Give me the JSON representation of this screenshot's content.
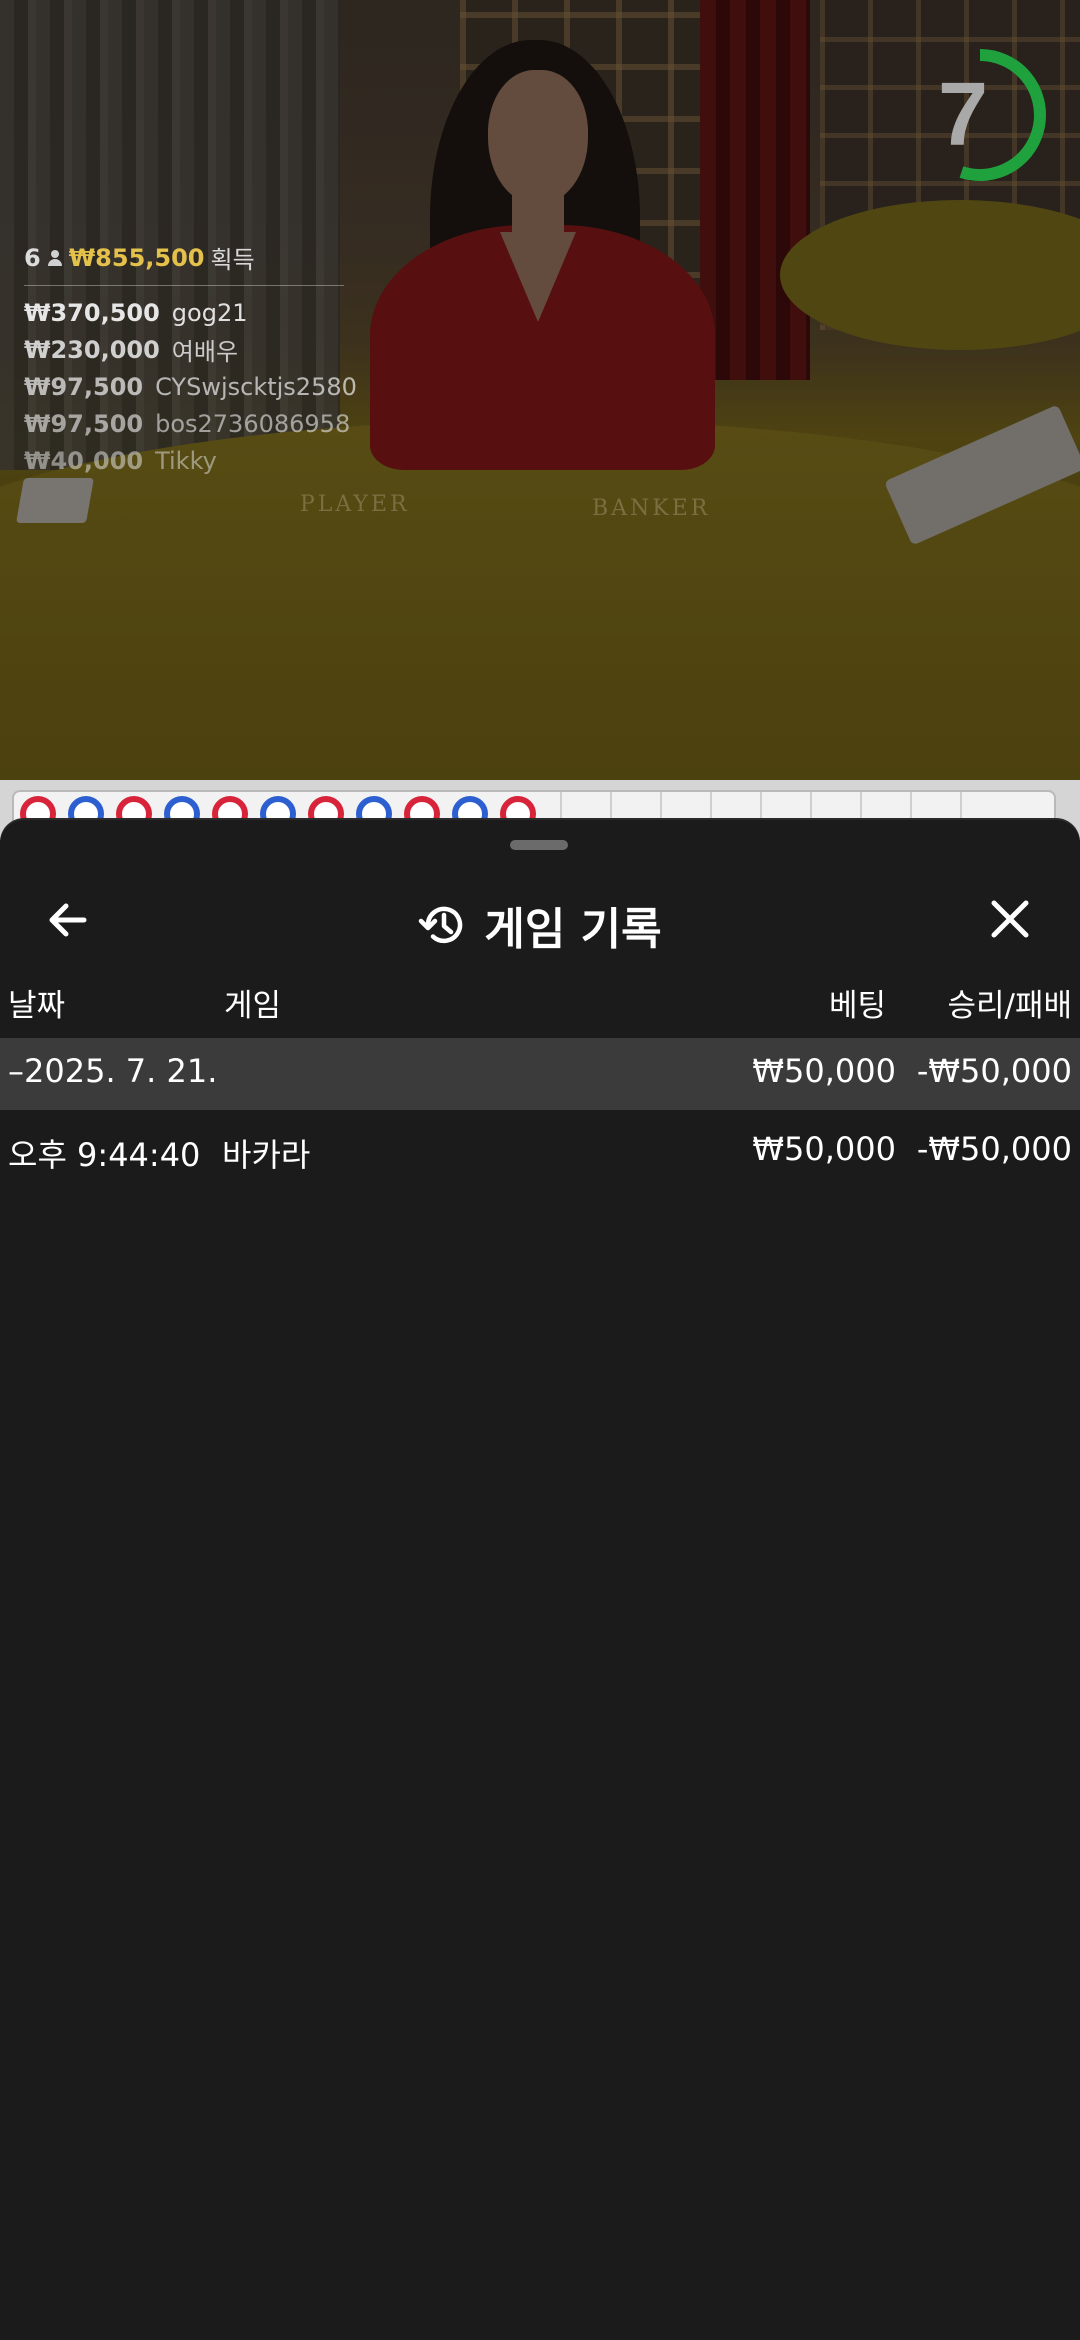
{
  "video": {
    "table_labels": {
      "player": "PLAYER",
      "banker": "BANKER"
    },
    "timer": {
      "value": "7",
      "ring_color": "#1fa23e",
      "remaining_fraction": 0.55
    }
  },
  "winners": {
    "count": "6",
    "total": "₩855,500",
    "total_label": "획득",
    "rows": [
      {
        "amount": "₩370,500",
        "name": "gog21"
      },
      {
        "amount": "₩230,000",
        "name": "여배우"
      },
      {
        "amount": "₩97,500",
        "name": "CYSwjscktjs2580"
      },
      {
        "amount": "₩97,500",
        "name": "bos2736086958"
      },
      {
        "amount": "₩40,000",
        "name": "Tikky"
      }
    ]
  },
  "bead_road": [
    "banker",
    "player",
    "banker",
    "player",
    "banker",
    "player",
    "banker",
    "player",
    "banker",
    "player",
    "banker"
  ],
  "colors": {
    "banker": "#d8243a",
    "player": "#2d5fd0",
    "sheet_bg": "#1b1b1b",
    "row_highlight": "#3b3b3b"
  },
  "history": {
    "title": "게임 기록",
    "icons": {
      "back": "arrow-left-icon",
      "history": "history-icon",
      "close": "close-icon"
    },
    "columns": {
      "date": "날짜",
      "game": "게임",
      "bet": "베팅",
      "result": "승리/패배"
    },
    "summary_row": {
      "date": "–2025. 7. 21.",
      "bet": "₩50,000",
      "result": "-₩50,000"
    },
    "rows": [
      {
        "time": "오후 9:44:40",
        "game": "바카라",
        "bet": "₩50,000",
        "result": "-₩50,000"
      }
    ]
  }
}
